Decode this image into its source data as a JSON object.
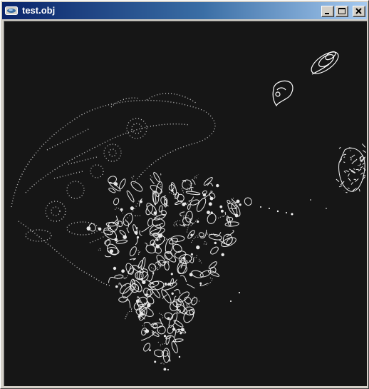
{
  "window": {
    "title": "test.obj",
    "app_icon": "app-window-icon",
    "controls": [
      "minimize-icon",
      "maximize-icon",
      "close-icon"
    ]
  },
  "viewport": {
    "background_color": "#161616",
    "point_color": "#ffffff",
    "content": "3d-mesh-point-cloud"
  }
}
